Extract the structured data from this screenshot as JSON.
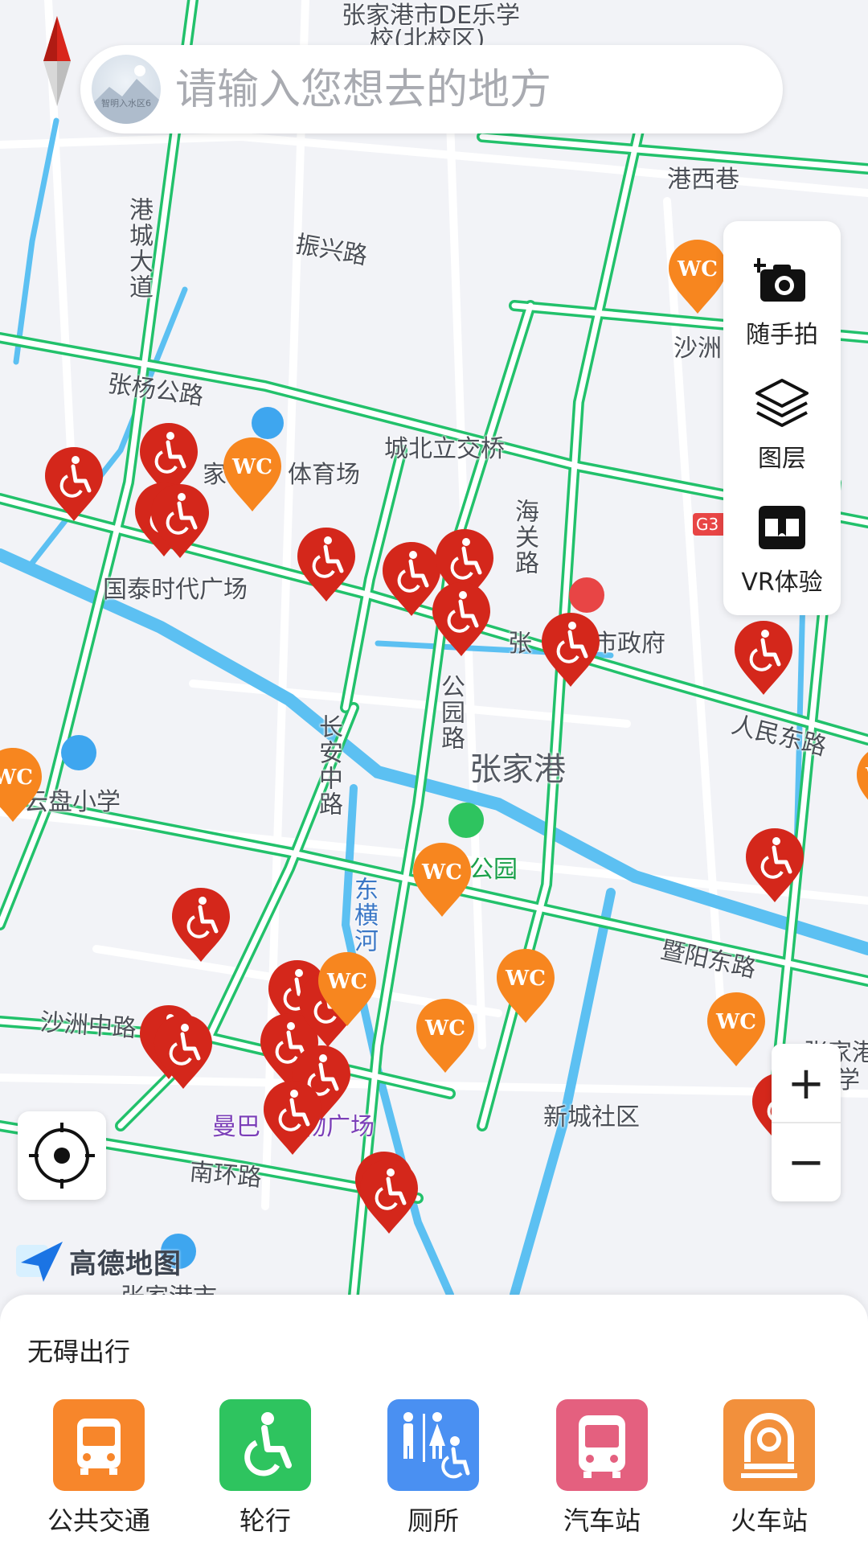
{
  "search": {
    "placeholder": "请输入您想去的地方",
    "avatar_caption": "智明入水区6"
  },
  "map_labels": {
    "school_north": "张家港市DE乐学",
    "school_north2": "校(北校区)",
    "gangxi": "港西巷",
    "zhenxing": "振兴路",
    "gangcheng": "港城大道",
    "zhangyang": "张杨公路",
    "tiyuchang_a": "家",
    "tiyuchang_b": "体育场",
    "chengbei": "城北立交桥",
    "haiguan": "海关路",
    "guotai": "国泰时代广场",
    "shazhou_top": "沙洲",
    "g3": "G3",
    "shizhengfu_a": "张",
    "shizhengfu_b": "市政府",
    "gongyuan_rd": "公园路",
    "zhangjiagang": "张家港",
    "renmin": "人民东路",
    "changan": "长安中路",
    "yunpan": "云盘小学",
    "gongyuan": "公园",
    "dongheng": "东横河",
    "jiyang": "暨阳东路",
    "shazhou_mid": "沙洲中路",
    "xincheng": "新城社区",
    "manbai_a": "曼巴",
    "manbai_b": "物广场",
    "nanhuan": "南环路",
    "right_edge_a": "张家港",
    "right_edge_b": "高学",
    "bottom_left": "张家港市"
  },
  "markers": {
    "wheelchair_count": 22,
    "wc_count": 10,
    "wc_label": "WC"
  },
  "tools": [
    {
      "label": "随手拍",
      "icon": "camera-add-icon"
    },
    {
      "label": "图层",
      "icon": "layers-icon"
    },
    {
      "label": "VR体验",
      "icon": "vr-headset-icon"
    }
  ],
  "zoom": {
    "in": "+",
    "out": "−"
  },
  "logo": {
    "text": "高德地图"
  },
  "panel": {
    "title": "无碍出行",
    "categories": [
      {
        "label": "公共交通",
        "icon": "bus-icon",
        "color": "#f7862b"
      },
      {
        "label": "轮行",
        "icon": "wheelchair-icon",
        "color": "#2ec45f"
      },
      {
        "label": "厕所",
        "icon": "restroom-icon",
        "color": "#4a90f2"
      },
      {
        "label": "汽车站",
        "icon": "coach-icon",
        "color": "#e4607f"
      },
      {
        "label": "火车站",
        "icon": "train-icon",
        "color": "#f2903c"
      }
    ]
  },
  "colors": {
    "road_green": "#22c16b",
    "water_blue": "#5cc0f2",
    "wheelchair_red": "#d4271b",
    "wc_orange": "#f7861f"
  }
}
